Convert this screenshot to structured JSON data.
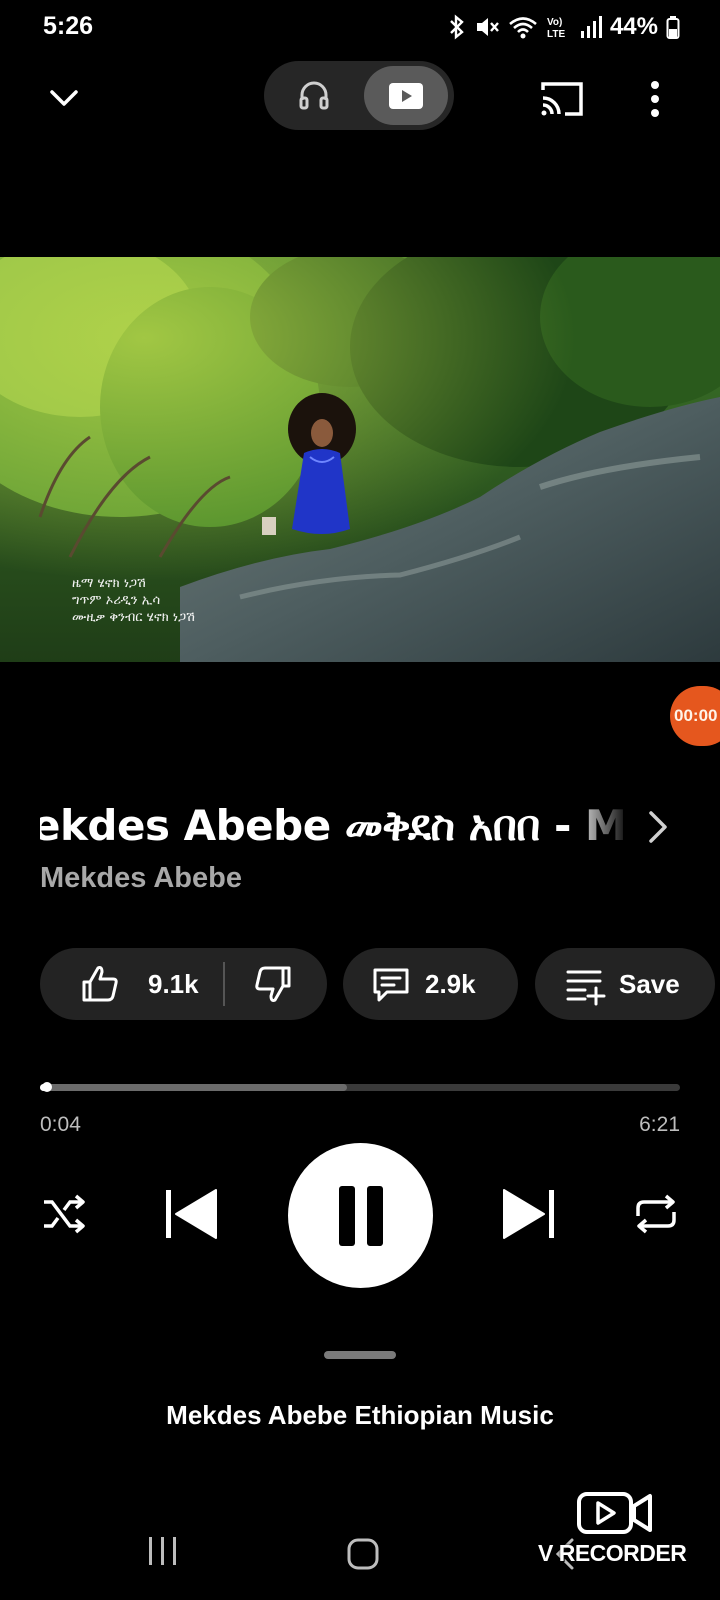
{
  "status_bar": {
    "time": "5:26",
    "battery": "44%",
    "icons": [
      "bluetooth-icon",
      "mute-icon",
      "wifi-icon",
      "volte-icon",
      "signal-icon",
      "battery-icon"
    ]
  },
  "top_bar": {
    "icons": [
      "chevron-down-icon",
      "headphones-icon",
      "video-icon",
      "cast-icon",
      "more-vertical-icon"
    ],
    "mode_selected": "video"
  },
  "video": {
    "credits": [
      "ዜማ ሄኖክ ነጋሽ",
      "ግጥም ኦሪዲን ኢሳ",
      "ሙዚቃ ቅንብር ሄኖክ ነጋሽ"
    ]
  },
  "recorder_bubble": "00:00",
  "song": {
    "title": "ekdes Abebe መቅደስ አበበ - M",
    "artist": "Mekdes Abebe"
  },
  "actions": {
    "likes": "9.1k",
    "comments": "2.9k",
    "save_label": "Save"
  },
  "playback": {
    "current_time": "0:04",
    "total_time": "6:21",
    "progress_fraction": 0.011,
    "buffered_fraction": 0.48
  },
  "up_next": "Mekdes Abebe Ethiopian Music",
  "watermark": "V RECORDER",
  "colors": {
    "background": "#000000",
    "chip": "#232323",
    "artist": "#a8a8a8",
    "recorder_bubble": "#e5571e"
  }
}
